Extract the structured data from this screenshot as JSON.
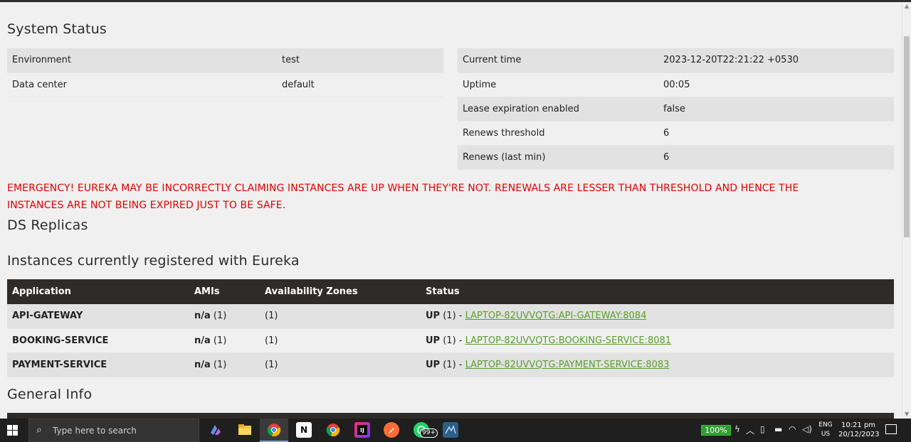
{
  "system_status": {
    "title": "System Status",
    "left": [
      {
        "label": "Environment",
        "value": "test"
      },
      {
        "label": "Data center",
        "value": "default"
      }
    ],
    "right": [
      {
        "label": "Current time",
        "value": "2023-12-20T22:21:22 +0530"
      },
      {
        "label": "Uptime",
        "value": "00:05"
      },
      {
        "label": "Lease expiration enabled",
        "value": "false"
      },
      {
        "label": "Renews threshold",
        "value": "6"
      },
      {
        "label": "Renews (last min)",
        "value": "6"
      }
    ]
  },
  "emergency": {
    "line1": "EMERGENCY! EUREKA MAY BE INCORRECTLY CLAIMING INSTANCES ARE UP WHEN THEY'RE NOT. RENEWALS ARE LESSER THAN THRESHOLD AND HENCE THE",
    "line2": "INSTANCES ARE NOT BEING EXPIRED JUST TO BE SAFE."
  },
  "ds_replicas": {
    "title": "DS Replicas"
  },
  "instances": {
    "title": "Instances currently registered with Eureka",
    "columns": [
      "Application",
      "AMIs",
      "Availability Zones",
      "Status"
    ],
    "rows": [
      {
        "application": "API-GATEWAY",
        "amis_na": "n/a",
        "amis_count": "(1)",
        "zones": "(1)",
        "status_up": "UP",
        "status_count": "(1) -",
        "link": "LAPTOP-82UVVQTG:API-GATEWAY:8084"
      },
      {
        "application": "BOOKING-SERVICE",
        "amis_na": "n/a",
        "amis_count": "(1)",
        "zones": "(1)",
        "status_up": "UP",
        "status_count": "(1) -",
        "link": "LAPTOP-82UVVQTG:BOOKING-SERVICE:8081"
      },
      {
        "application": "PAYMENT-SERVICE",
        "amis_na": "n/a",
        "amis_count": "(1)",
        "zones": "(1)",
        "status_up": "UP",
        "status_count": "(1) -",
        "link": "LAPTOP-82UVVQTG:PAYMENT-SERVICE:8083"
      }
    ]
  },
  "general_info": {
    "title": "General Info"
  },
  "taskbar": {
    "search_placeholder": "Type here to search",
    "whatsapp_badge": "99+",
    "battery_percent": "100%",
    "battery_level": 1.0,
    "lang_top": "ENG",
    "lang_bottom": "US",
    "time": "10:21 pm",
    "date": "20/12/2023",
    "icons": [
      "windows-start-icon",
      "copilot-icon",
      "file-explorer-icon",
      "chrome-icon",
      "notion-icon",
      "chrome-icon",
      "intellij-icon",
      "postman-icon",
      "whatsapp-icon",
      "mysql-workbench-icon"
    ]
  },
  "colors": {
    "emergency": "#e00000",
    "link": "#5b9e2f",
    "table_header": "#2e2b28",
    "row_shade": "#e2e2e2",
    "battery_green": "#2f9e2f"
  }
}
